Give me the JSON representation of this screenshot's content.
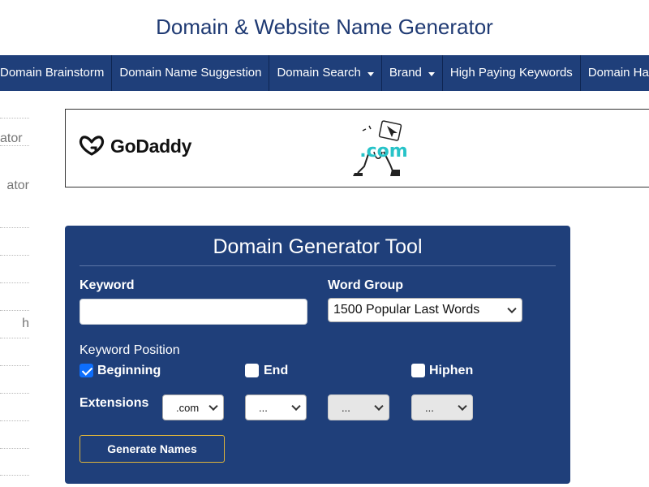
{
  "header": {
    "title": "Domain & Website Name Generator"
  },
  "nav": {
    "items": [
      {
        "label": "Domain Brainstorm",
        "dropdown": false
      },
      {
        "label": "Domain Name Suggestion",
        "dropdown": false
      },
      {
        "label": "Domain Search",
        "dropdown": true
      },
      {
        "label": "Brand",
        "dropdown": true
      },
      {
        "label": "High Paying Keywords",
        "dropdown": false
      },
      {
        "label": "Domain Ha",
        "dropdown": false
      }
    ]
  },
  "sidebar": {
    "items": [
      "",
      "ator",
      "ator",
      "",
      "",
      "",
      "h",
      "",
      "",
      "",
      ""
    ]
  },
  "ad": {
    "brand": "GoDaddy",
    "art_text": ".com",
    "colors": {
      "brand": "#111111",
      "art": "#27c3c8"
    }
  },
  "tool": {
    "title": "Domain Generator Tool",
    "keyword": {
      "label": "Keyword",
      "value": "",
      "placeholder": ""
    },
    "word_group": {
      "label": "Word Group",
      "selected": "1500 Popular Last Words"
    },
    "position": {
      "label": "Keyword Position",
      "options": [
        {
          "label": "Beginning",
          "checked": true
        },
        {
          "label": "End",
          "checked": false
        },
        {
          "label": "Hiphen",
          "checked": false
        }
      ]
    },
    "extensions": {
      "label": "Extensions",
      "values": [
        ".com",
        "...",
        "...",
        "..."
      ],
      "disabled": [
        false,
        false,
        true,
        true
      ]
    },
    "generate_label": "Generate Names"
  },
  "colors": {
    "nav_bg": "#1f3f7a",
    "title": "#1f3a73",
    "panel_bg": "#1f3f7a",
    "button_border": "#e0b53a",
    "checkbox": "#0d6efd"
  }
}
